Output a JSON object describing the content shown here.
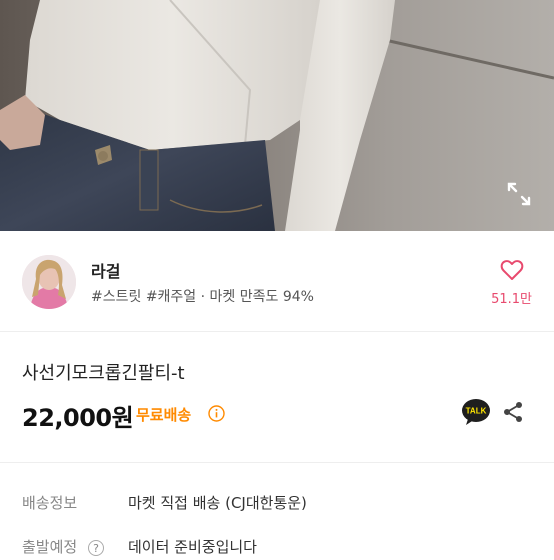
{
  "seller": {
    "name": "라걸",
    "tags": "#스트릿 #캐주얼 · 마켓 만족도 94%",
    "like_count": "51.1만"
  },
  "product": {
    "title": "사선기모크롭긴팔티-t",
    "price": "22,000원",
    "shipping_badge": "무료배송",
    "talk_label": "TALK"
  },
  "delivery": {
    "shipping_info_label": "배송정보",
    "shipping_info_value": "마켓 직접 배송 (CJ대한통운)",
    "departure_label": "출발예정",
    "departure_help": "?",
    "departure_value": "데이터 준비중입니다"
  },
  "colors": {
    "accent_pink": "#e84a6e",
    "free_shipping_orange": "#ff8a00"
  },
  "icons": [
    "expand-icon",
    "heart-icon",
    "info-icon",
    "kakao-talk-icon",
    "share-icon",
    "help-icon"
  ]
}
